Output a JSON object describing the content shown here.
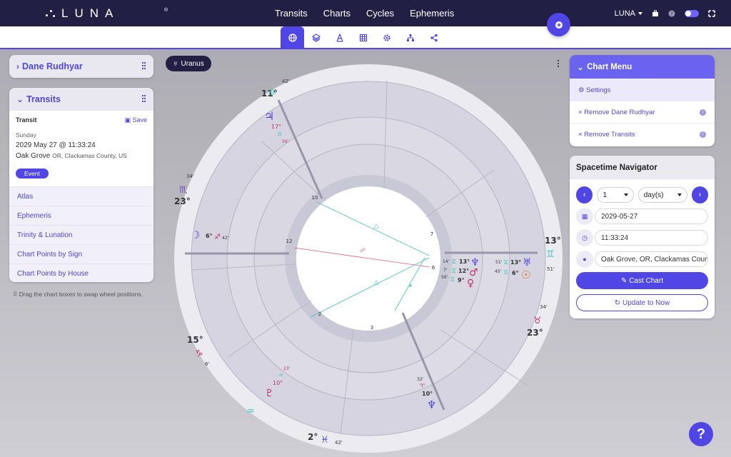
{
  "app": {
    "logo_text": "LUNA",
    "logo_reg": "®",
    "nav": [
      "Transits",
      "Charts",
      "Cycles",
      "Ephemeris"
    ],
    "user_menu": "LUNA"
  },
  "tabs": [
    "globe",
    "layers",
    "aspect",
    "grid",
    "settings",
    "hierarchy",
    "share"
  ],
  "pill": {
    "label": "Uranus",
    "glyph": "♅"
  },
  "natal_panel": {
    "title": "Dane Rudhyar"
  },
  "transits_panel": {
    "title": "Transits",
    "kind": "Transit",
    "save_label": "Save",
    "weekday": "Sunday",
    "datetime": "2029 May 27 @ 11:33:24",
    "place": "Oak Grove",
    "region": "OR, Clackamas County, US",
    "badge": "Event",
    "menu": [
      "Atlas",
      "Ephemeris",
      "Trinity & Lunation",
      "Chart Points by Sign",
      "Chart Points by House"
    ]
  },
  "drag_hint": "Drag the chart boxes to swap wheel positions.",
  "chart_menu": {
    "title": "Chart Menu",
    "items": [
      "Settings",
      "Remove Dane Rudhyar",
      "Remove Transits"
    ]
  },
  "navigator": {
    "title": "Spacetime Navigator",
    "step_value": "1",
    "step_unit": "day(s)",
    "date": "2029-05-27",
    "time": "11:33:24",
    "location": "Oak Grove, OR, Clackamas County, US",
    "cast_label": "Cast Chart",
    "update_label": "Update to Now"
  },
  "wheel": {
    "house_numbers": [
      "10",
      "12",
      "7",
      "6",
      "2",
      "3"
    ],
    "cusps": [
      {
        "deg": "11°",
        "min": "42'",
        "sign": "♎"
      },
      {
        "deg": "23°",
        "min": "34'",
        "sign": "♏"
      },
      {
        "deg": "15°",
        "min": "6'",
        "sign": "♑"
      },
      {
        "deg": "2°",
        "min": "42'",
        "sign": "♓"
      },
      {
        "deg": "23°",
        "min": "34'",
        "sign": "♉"
      },
      {
        "deg": "13°",
        "min": "51'",
        "sign": "♊"
      }
    ],
    "planets": [
      {
        "glyph": "♃",
        "deg": "17°",
        "sign": "♎",
        "min": "56'"
      },
      {
        "glyph": "☽",
        "deg": "6°",
        "sign": "♐",
        "min": "42'"
      },
      {
        "glyph": "♆",
        "deg": "13°",
        "sign": "♊",
        "min": "14'"
      },
      {
        "glyph": "♂",
        "deg": "12°",
        "sign": "♊",
        "min": "7'"
      },
      {
        "glyph": "♀",
        "deg": "9°",
        "sign": "♊",
        "min": "56'"
      },
      {
        "glyph": "♅",
        "deg": "13°",
        "sign": "♊",
        "min": "51'"
      },
      {
        "glyph": "☉",
        "deg": "6°",
        "sign": "♊",
        "min": "45'"
      },
      {
        "glyph": "♇",
        "deg": "10°",
        "sign": "♒",
        "min": "23'"
      },
      {
        "glyph": "♆",
        "deg": "10°",
        "sign": "♈",
        "min": "32'"
      }
    ],
    "help": "?"
  }
}
